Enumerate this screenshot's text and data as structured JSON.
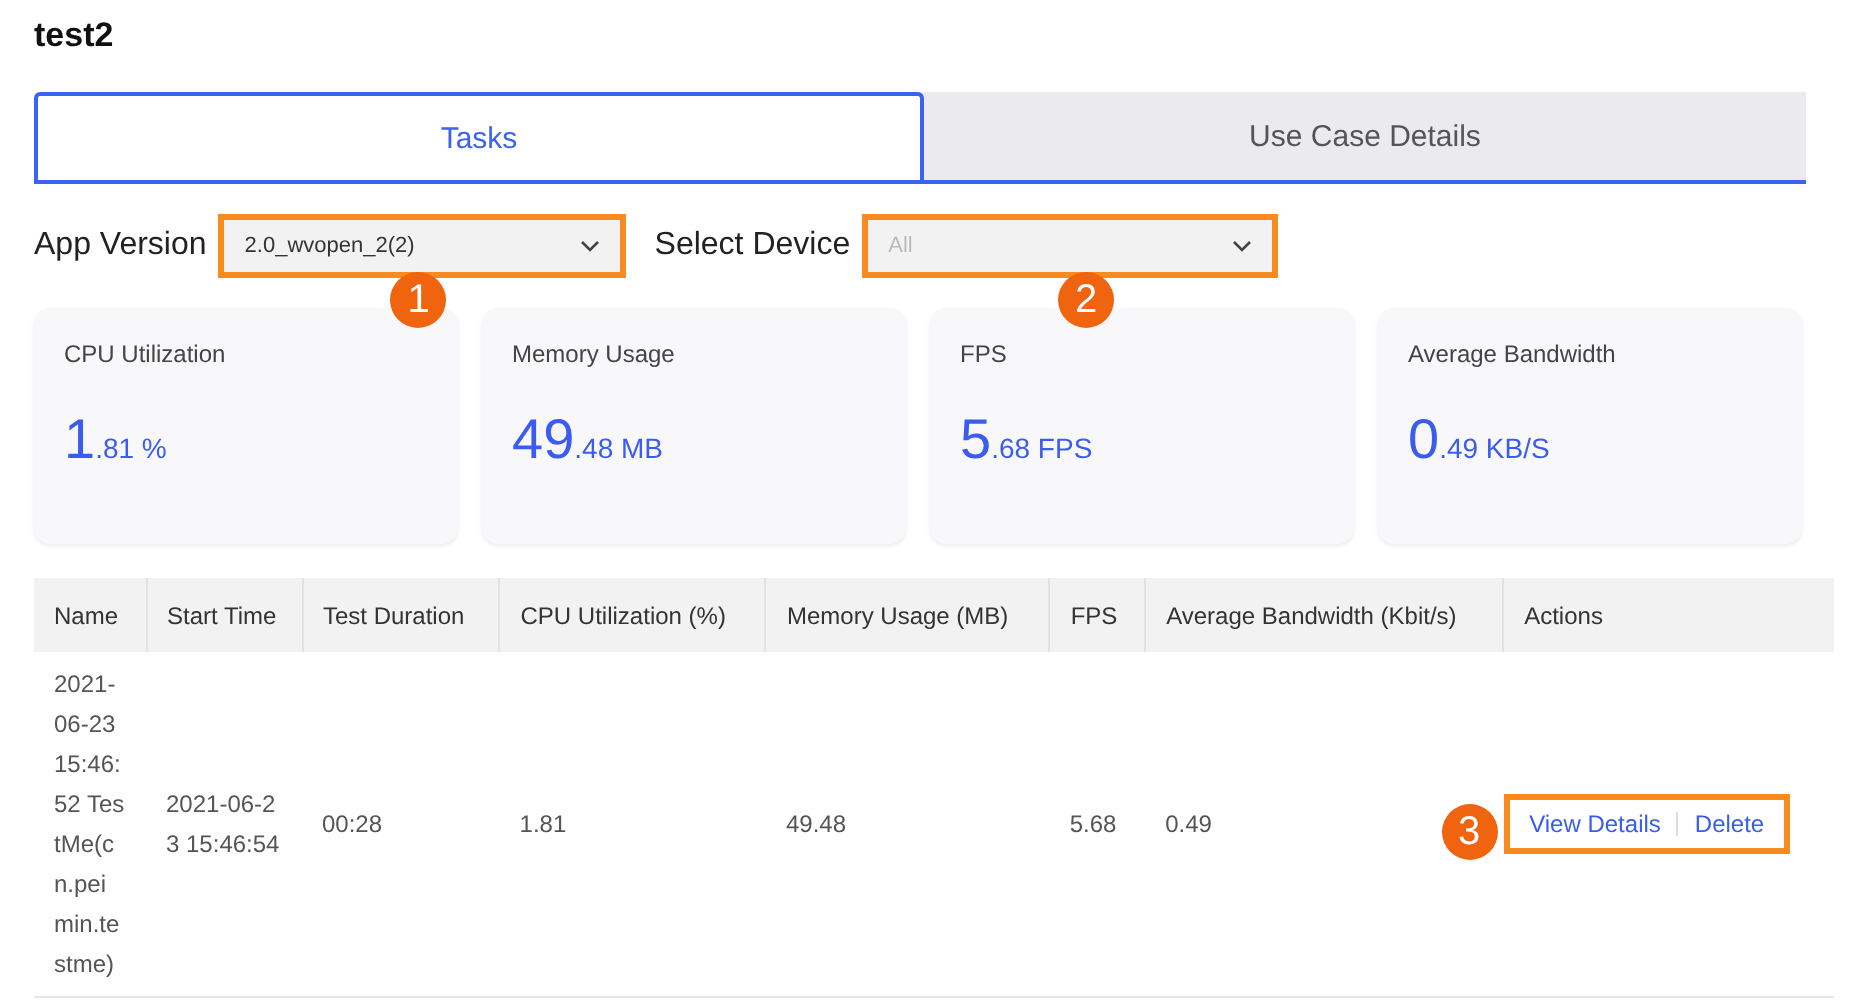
{
  "title": "test2",
  "tabs": [
    {
      "label": "Tasks",
      "selected": true
    },
    {
      "label": "Use Case Details",
      "selected": false
    }
  ],
  "filters": [
    {
      "label": "App Version",
      "value": "2.0_wvopen_2(2)",
      "marker": "1"
    },
    {
      "label": "Select Device",
      "placeholder": "All",
      "marker": "2"
    }
  ],
  "metrics": [
    {
      "label": "CPU Utilization",
      "whole": "1",
      "rest": ".81 %"
    },
    {
      "label": "Memory Usage",
      "whole": "49",
      "rest": ".48 MB"
    },
    {
      "label": "FPS",
      "whole": "5",
      "rest": ".68 FPS"
    },
    {
      "label": "Average Bandwidth",
      "whole": "0",
      "rest": ".49 KB/S"
    }
  ],
  "table": {
    "columns": [
      "Name",
      "Start Time",
      "Test Duration",
      "CPU Utilization (%)",
      "Memory Usage (MB)",
      "FPS",
      "Average Bandwidth (Kbit/s)",
      "Actions"
    ],
    "rows": [
      {
        "cells": [
          "2021-06-23 15:46:52 TestMe(cn.peimin.testme)",
          "2021-06-23 15:46:54",
          "00:28",
          "1.81",
          "49.48",
          "5.68",
          "0.49"
        ],
        "actions": [
          "View Details",
          "Delete"
        ],
        "marker": "3"
      }
    ]
  }
}
